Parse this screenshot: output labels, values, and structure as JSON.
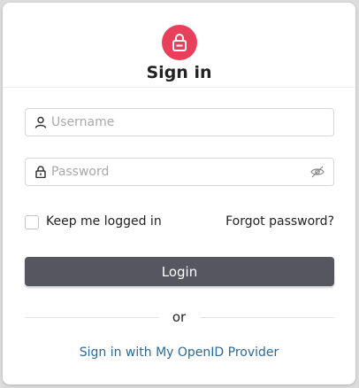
{
  "header": {
    "title": "Sign in",
    "icon": "lock-icon",
    "accent_color": "#e8405a"
  },
  "form": {
    "username": {
      "placeholder": "Username",
      "icon": "user-icon"
    },
    "password": {
      "placeholder": "Password",
      "icon": "lock-icon",
      "toggle_icon": "eye-slash-icon"
    },
    "remember_label": "Keep me logged in",
    "forgot_label": "Forgot password?",
    "login_label": "Login",
    "login_color": "#555660"
  },
  "alt": {
    "or_label": "or",
    "openid_label": "Sign in with My OpenID Provider",
    "link_color": "#2a6a95"
  }
}
